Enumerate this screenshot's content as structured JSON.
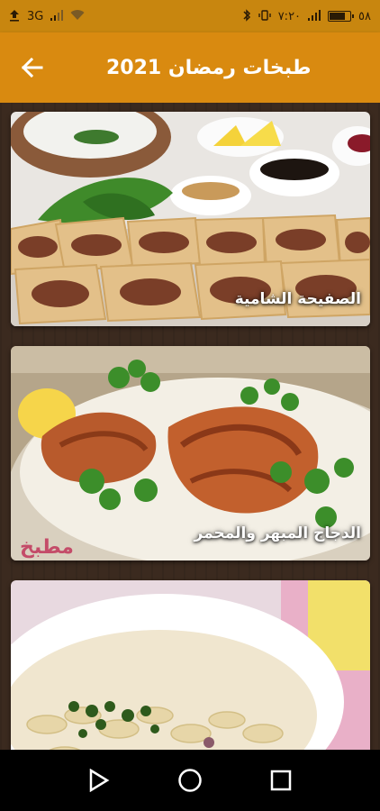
{
  "status_bar": {
    "left_icons": [
      "upload-icon",
      "signal-3g-icon",
      "wifi-icon"
    ],
    "network_label": "3G",
    "time_text": "٧:٢٠",
    "battery_percent": "٥٨",
    "battery_level": 0.7
  },
  "app_bar": {
    "title": "طبخات رمضان 2021",
    "back_icon": "arrow-back-icon"
  },
  "recipes": [
    {
      "label": "الصفيحة الشامية"
    },
    {
      "label": "الدجاج المبهر والمحمر"
    },
    {
      "label": ""
    }
  ],
  "nav_bar": {
    "buttons": [
      "back-triangle-icon",
      "home-circle-icon",
      "recents-square-icon"
    ]
  },
  "colors": {
    "status_bar": "#c8860f",
    "app_bar": "#d98a10",
    "background": "#3b2a1f"
  }
}
